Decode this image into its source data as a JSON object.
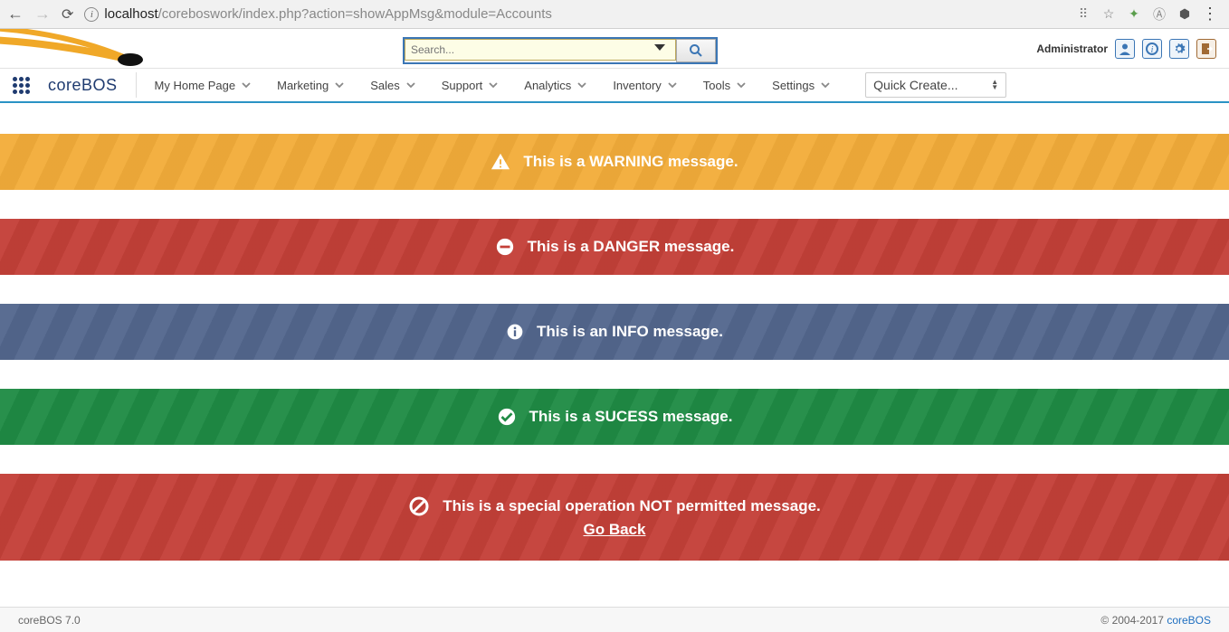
{
  "browser": {
    "url_host": "localhost",
    "url_path": "/coreboswork/index.php?action=showAppMsg&module=Accounts"
  },
  "header": {
    "search_placeholder": "Search...",
    "admin_label": "Administrator"
  },
  "nav": {
    "brand": "coreBOS",
    "items": [
      "My Home Page",
      "Marketing",
      "Sales",
      "Support",
      "Analytics",
      "Inventory",
      "Tools",
      "Settings"
    ],
    "quick_create": "Quick Create..."
  },
  "messages": {
    "warning": "This is a WARNING message.",
    "danger": "This is a DANGER message.",
    "info": "This is an INFO message.",
    "success": "This is a SUCESS message.",
    "not_permitted": "This is a special operation NOT permitted message.",
    "go_back": "Go Back"
  },
  "footer": {
    "left": "coreBOS 7.0",
    "right_prefix": "© 2004-2017 ",
    "right_link": "coreBOS"
  }
}
